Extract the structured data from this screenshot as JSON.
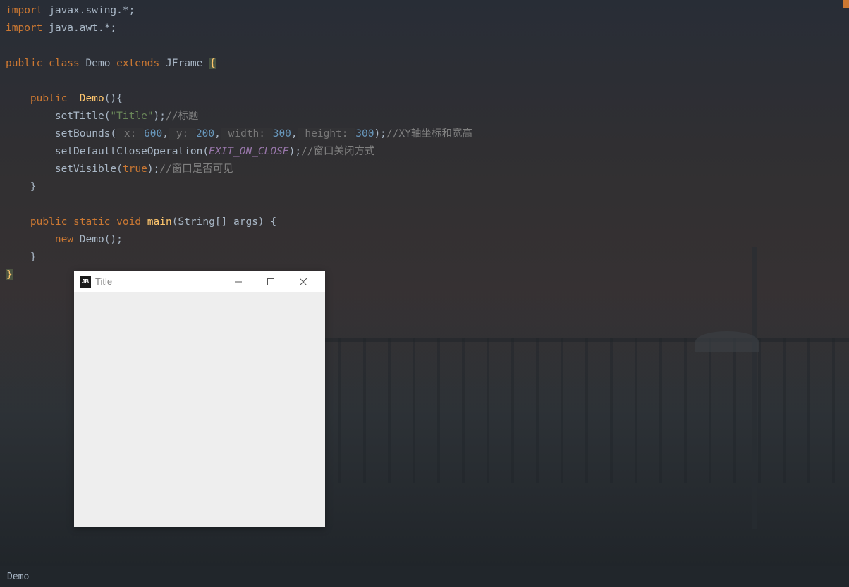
{
  "code": {
    "line1_import": "import",
    "line1_rest": " javax.swing.*;",
    "line2_import": "import",
    "line2_rest": " java.awt.*;",
    "line4_public": "public ",
    "line4_class": "class ",
    "line4_name": "Demo ",
    "line4_extends": "extends ",
    "line4_parent": "JFrame ",
    "line4_brace": "{",
    "line6_indent": "    ",
    "line6_public": "public  ",
    "line6_method": "Demo",
    "line6_rest": "(){",
    "line7_indent": "        ",
    "line7_method": "setTitle",
    "line7_paren1": "(",
    "line7_string": "\"Title\"",
    "line7_paren2": ");",
    "line7_comment": "//标题",
    "line8_indent": "        ",
    "line8_method": "setBounds",
    "line8_paren1": "(",
    "line8_hint_x": " x: ",
    "line8_val_x": "600",
    "line8_comma1": ",",
    "line8_hint_y": " y: ",
    "line8_val_y": "200",
    "line8_comma2": ",",
    "line8_hint_w": " width: ",
    "line8_val_w": "300",
    "line8_comma3": ",",
    "line8_hint_h": " height: ",
    "line8_val_h": "300",
    "line8_paren2": ");",
    "line8_comment": "//XY轴坐标和宽高",
    "line9_indent": "        ",
    "line9_method": "setDefaultCloseOperation",
    "line9_paren1": "(",
    "line9_const": "EXIT_ON_CLOSE",
    "line9_paren2": ");",
    "line9_comment": "//窗口关闭方式",
    "line10_indent": "        ",
    "line10_method": "setVisible",
    "line10_paren1": "(",
    "line10_bool": "true",
    "line10_paren2": ");",
    "line10_comment": "//窗口是否可见",
    "line11_indent": "    ",
    "line11_brace": "}",
    "line13_indent": "    ",
    "line13_public": "public ",
    "line13_static": "static ",
    "line13_void": "void ",
    "line13_method": "main",
    "line13_params": "(String[] args) {",
    "line14_indent": "        ",
    "line14_new": "new ",
    "line14_class": "Demo",
    "line14_rest": "();",
    "line15_indent": "    ",
    "line15_brace": "}",
    "line16_brace": "}"
  },
  "swing": {
    "icon_text": "JB",
    "title": "Title"
  },
  "status": {
    "breadcrumb": "Demo"
  }
}
